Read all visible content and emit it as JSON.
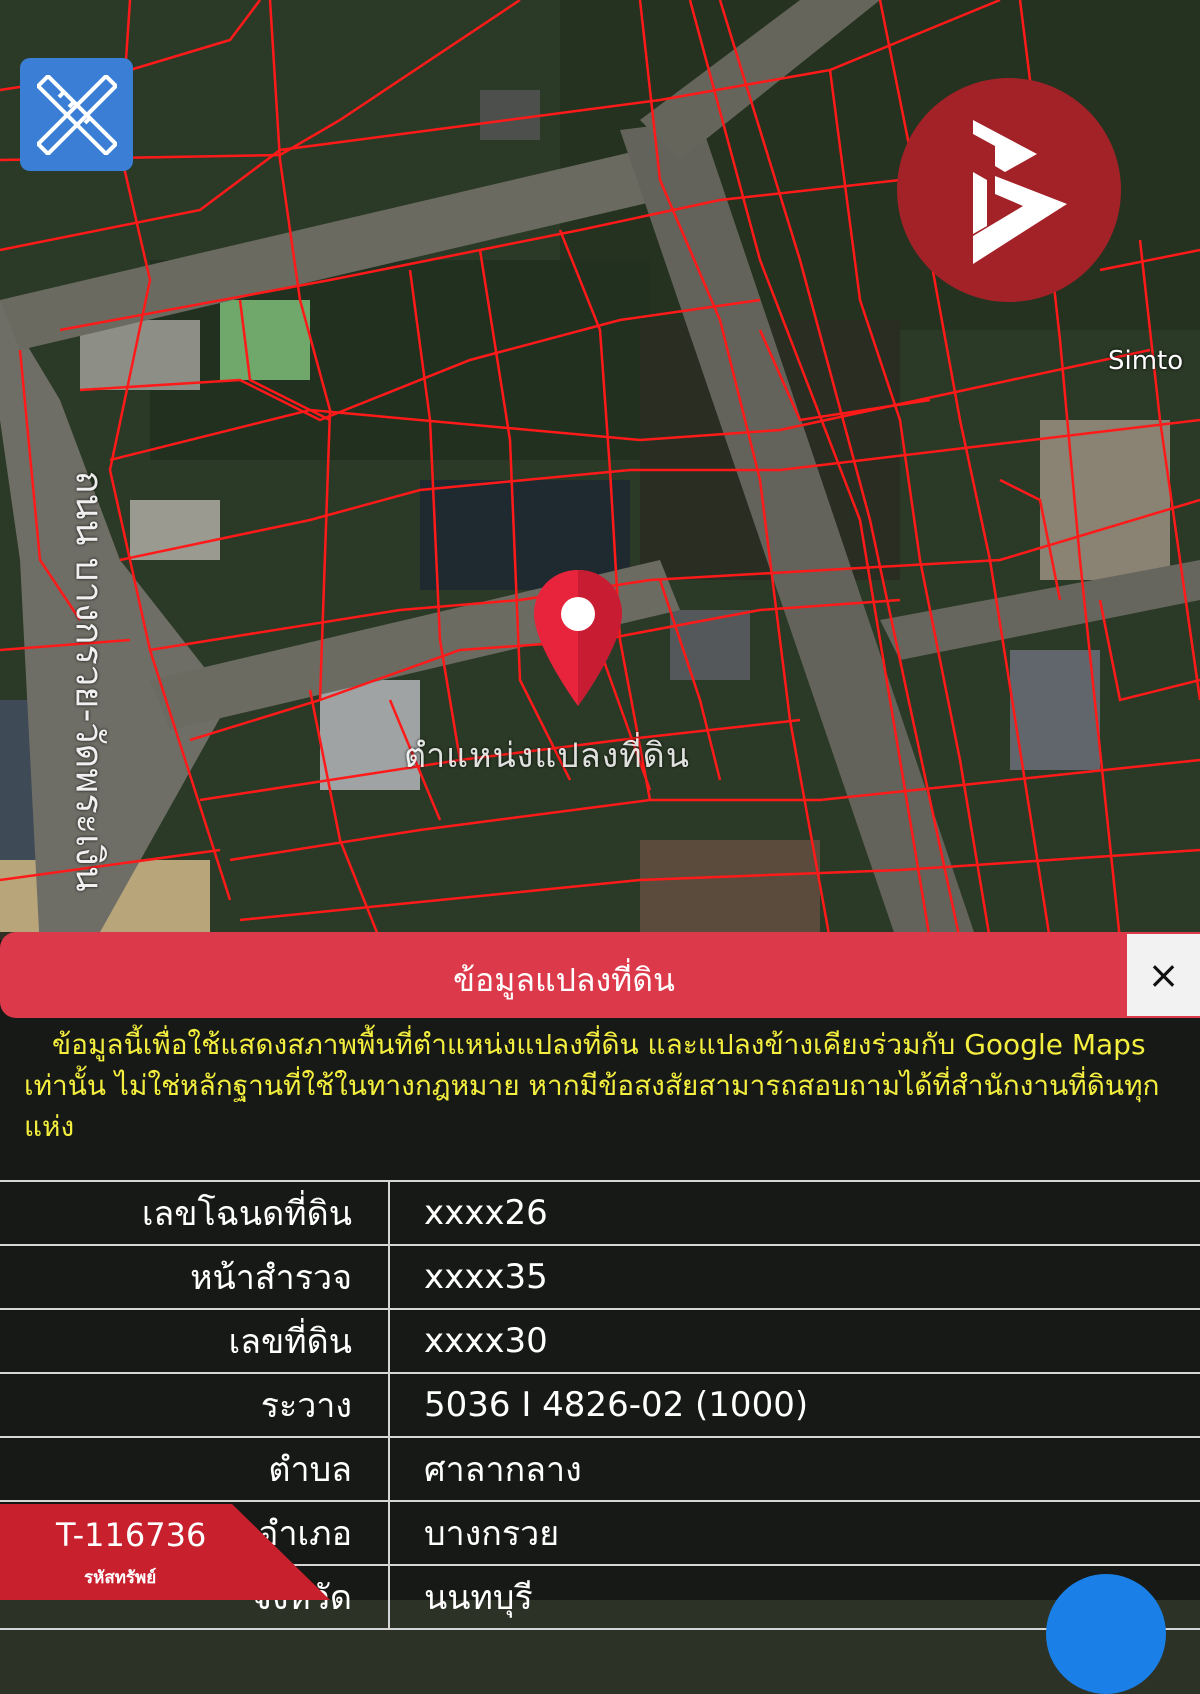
{
  "map": {
    "pin_label": "ตำแหน่งแปลงที่ดิน",
    "road_label": "ถนน บางกรวย-วัดพระเงิน",
    "place_label_right": "Simto",
    "pin_color": "#e8243c",
    "parcel_line_color": "#ff1a1a"
  },
  "toolbar": {
    "tool_icon": "ruler-pencil-icon",
    "tool_color": "#3a7fd5"
  },
  "brand": {
    "logo_icon": "brand-b-logo-icon",
    "color": "#a32228"
  },
  "panel": {
    "title": "ข้อมูลแปลงที่ดิน",
    "close_label": "×",
    "header_color": "#dc3a4a",
    "notice": "ข้อมูลนี้เพื่อใช้แสดงสภาพพื้นที่ตำแหน่งแปลงที่ดิน และแปลงข้างเคียงร่วมกับ Google Maps เท่านั้น ไม่ใช่หลักฐานที่ใช้ในทางกฎหมาย หากมีข้อสงสัยสามารถสอบถามได้ที่สำนักงานที่ดินทุกแห่ง",
    "notice_color": "#f4ee3e",
    "rows": [
      {
        "label": "เลขโฉนดที่ดิน",
        "value": "xxxx26"
      },
      {
        "label": "หน้าสำรวจ",
        "value": "xxxx35"
      },
      {
        "label": "เลขที่ดิน",
        "value": "xxxx30"
      },
      {
        "label": "ระวาง",
        "value": "5036 I 4826-02 (1000)"
      },
      {
        "label": "ตำบล",
        "value": "ศาลากลาง"
      },
      {
        "label": "อำเภอ",
        "value": "บางกรวย"
      },
      {
        "label": "จังหวัด",
        "value": "นนทบุรี"
      }
    ]
  },
  "asset": {
    "code": "T-116736",
    "code_label": "รหัสทรัพย์",
    "color": "#c8202c"
  }
}
